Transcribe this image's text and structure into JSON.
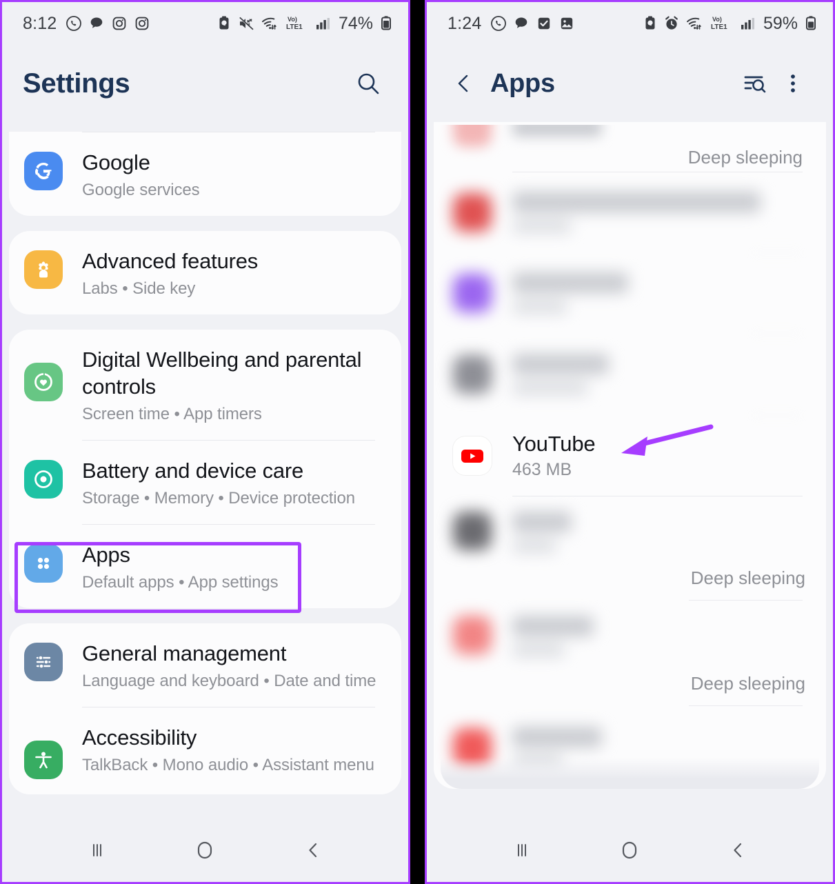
{
  "left_phone": {
    "status_bar": {
      "time": "8:12",
      "battery_percent": "74%",
      "network_label": "LTE1",
      "volte_label": "Vo)",
      "left_icons": [
        "whatsapp-icon",
        "chat-bubble-icon",
        "instagram-icon",
        "camera-icon"
      ],
      "right_icons": [
        "battery-saver-icon",
        "mute-icon",
        "wifi-icon",
        "volte-icon",
        "signal-bars-icon",
        "battery-icon"
      ]
    },
    "app_bar": {
      "title": "Settings",
      "search_icon": "search-icon"
    },
    "groups": [
      {
        "id": "group-google",
        "items": [
          {
            "title": "Google",
            "subtitle": "Google services",
            "icon": "google-icon",
            "icon_color": "#4a8bf0",
            "highlighted": false
          }
        ]
      },
      {
        "id": "group-advanced",
        "items": [
          {
            "title": "Advanced features",
            "subtitle": "Labs  •  Side key",
            "icon": "gear-flower-icon",
            "icon_color": "#f7b844",
            "highlighted": false
          }
        ]
      },
      {
        "id": "group-wellbeing",
        "items": [
          {
            "title": "Digital Wellbeing and parental controls",
            "subtitle": "Screen time  •  App timers",
            "icon": "heart-circle-icon",
            "icon_color": "#67c684",
            "highlighted": false
          },
          {
            "title": "Battery and device care",
            "subtitle": "Storage  •  Memory  •  Device protection",
            "icon": "battery-care-icon",
            "icon_color": "#1ec2a4",
            "highlighted": false
          },
          {
            "title": "Apps",
            "subtitle": "Default apps  •  App settings",
            "icon": "apps-grid-icon",
            "icon_color": "#62a9e8",
            "highlighted": true
          }
        ]
      },
      {
        "id": "group-general",
        "items": [
          {
            "title": "General management",
            "subtitle": "Language and keyboard  •  Date and time",
            "icon": "sliders-icon",
            "icon_color": "#6c87a5",
            "highlighted": false
          },
          {
            "title": "Accessibility",
            "subtitle": "TalkBack  •  Mono audio  •  Assistant menu",
            "icon": "accessibility-person-icon",
            "icon_color": "#37ad62",
            "highlighted": false
          }
        ]
      }
    ],
    "nav_bar": {
      "recents_label": "recent-apps",
      "home_label": "home",
      "back_label": "back"
    }
  },
  "right_phone": {
    "status_bar": {
      "time": "1:24",
      "battery_percent": "59%",
      "network_label": "LTE1",
      "volte_label": "Vo)",
      "left_icons": [
        "whatsapp-icon",
        "chat-bubble-icon",
        "task-check-icon",
        "gallery-icon"
      ],
      "right_icons": [
        "battery-saver-icon",
        "alarm-icon",
        "wifi-icon",
        "volte-icon",
        "signal-bars-icon",
        "battery-icon"
      ]
    },
    "app_bar": {
      "back_icon": "back-chevron-icon",
      "title": "Apps",
      "sort_search_icon": "sort-search-icon",
      "overflow_icon": "more-vertical-icon"
    },
    "app_rows": [
      {
        "id": "row-partial-top",
        "name": "",
        "size": "",
        "status": "Deep sleeping",
        "blurred": true,
        "partial": true,
        "icon_color": "#f0a0a0"
      },
      {
        "id": "row-blurred-1",
        "name": "",
        "size": "",
        "status": "",
        "blurred": true,
        "icon_color": "#e05252"
      },
      {
        "id": "row-blurred-2",
        "name": "",
        "size": "",
        "status": "",
        "blurred": true,
        "icon_color": "#9b66f0"
      },
      {
        "id": "row-blurred-3",
        "name": "",
        "size": "",
        "status": "",
        "blurred": true,
        "icon_color": "#8e8f96"
      },
      {
        "id": "row-youtube",
        "name": "YouTube",
        "size": "463 MB",
        "status": "",
        "blurred": false,
        "icon_color": "#ff0000",
        "annotated": true
      },
      {
        "id": "row-blurred-4",
        "name": "",
        "size": "",
        "status": "Deep sleeping",
        "blurred": true,
        "icon_color": "#6b6b70"
      },
      {
        "id": "row-blurred-5",
        "name": "",
        "size": "",
        "status": "Deep sleeping",
        "blurred": true,
        "icon_color": "#f28585"
      },
      {
        "id": "row-blurred-6",
        "name": "",
        "size": "",
        "status": "",
        "blurred": true,
        "icon_color": "#f05a5a"
      }
    ],
    "nav_bar": {
      "recents_label": "recent-apps",
      "home_label": "home",
      "back_label": "back"
    }
  },
  "annotations": {
    "highlight_color": "#a63dff",
    "arrow_target": "YouTube",
    "highlight_target": "Apps"
  }
}
